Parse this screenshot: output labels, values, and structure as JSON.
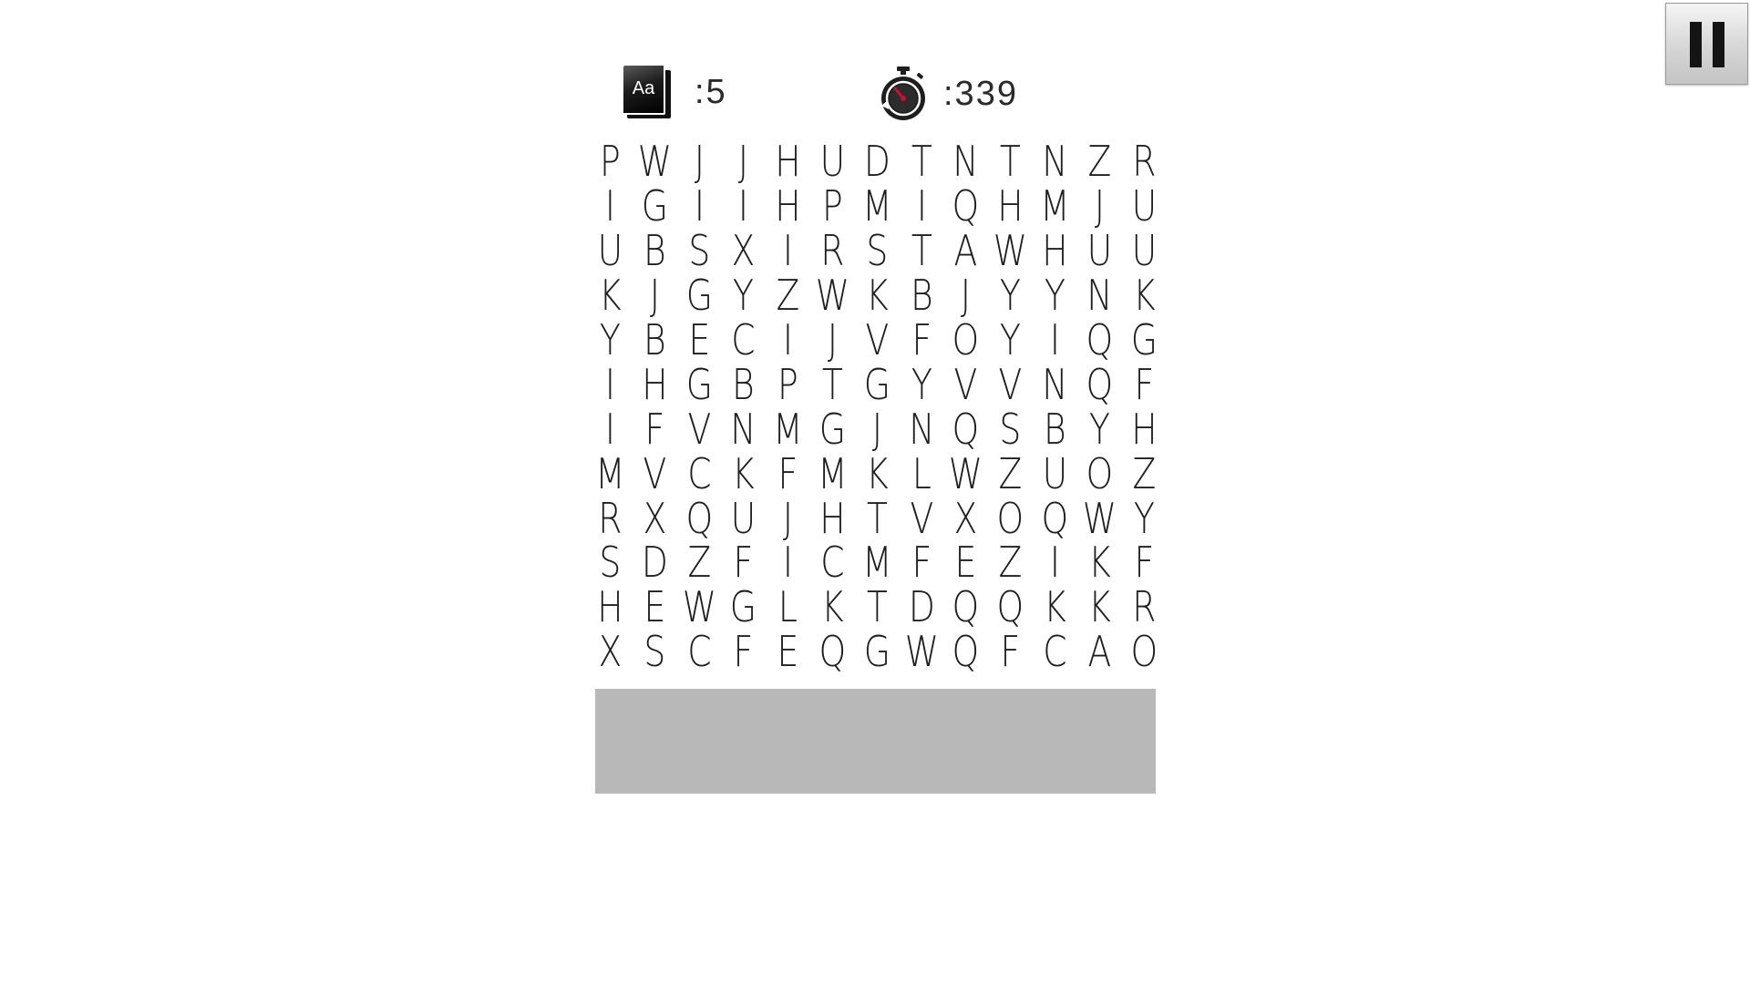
{
  "header": {
    "words_icon": "dictionary-icon",
    "words_icon_text": "Aa",
    "words_remaining": ":5",
    "timer_icon": "stopwatch-icon",
    "time_remaining": ":339"
  },
  "controls": {
    "pause_icon": "pause-icon"
  },
  "colors": {
    "background": "#ffffff",
    "letters": "#1e1e1e",
    "word_panel": "#b8b8b8",
    "timer_needle": "#c8102e"
  },
  "grid": {
    "rows": [
      [
        "P",
        "W",
        "J",
        "J",
        "H",
        "U",
        "D",
        "T",
        "N",
        "T",
        "N",
        "Z",
        "R"
      ],
      [
        "I",
        "G",
        "I",
        "I",
        "H",
        "P",
        "M",
        "I",
        "Q",
        "H",
        "M",
        "J",
        "U"
      ],
      [
        "U",
        "B",
        "S",
        "X",
        "I",
        "R",
        "S",
        "T",
        "A",
        "W",
        "H",
        "U",
        "U"
      ],
      [
        "K",
        "J",
        "G",
        "Y",
        "Z",
        "W",
        "K",
        "B",
        "J",
        "Y",
        "Y",
        "N",
        "K"
      ],
      [
        "Y",
        "B",
        "E",
        "C",
        "I",
        "J",
        "V",
        "F",
        "O",
        "Y",
        "I",
        "Q",
        "G"
      ],
      [
        "I",
        "H",
        "G",
        "B",
        "P",
        "T",
        "G",
        "Y",
        "V",
        "V",
        "N",
        "Q",
        "F"
      ],
      [
        "I",
        "F",
        "V",
        "N",
        "M",
        "G",
        "J",
        "N",
        "Q",
        "S",
        "B",
        "Y",
        "H"
      ],
      [
        "M",
        "V",
        "C",
        "K",
        "F",
        "M",
        "K",
        "L",
        "W",
        "Z",
        "U",
        "O",
        "Z"
      ],
      [
        "R",
        "X",
        "Q",
        "U",
        "J",
        "H",
        "T",
        "V",
        "X",
        "O",
        "Q",
        "W",
        "Y"
      ],
      [
        "S",
        "D",
        "Z",
        "F",
        "I",
        "C",
        "M",
        "F",
        "E",
        "Z",
        "I",
        "K",
        "F"
      ],
      [
        "H",
        "E",
        "W",
        "G",
        "L",
        "K",
        "T",
        "D",
        "Q",
        "Q",
        "K",
        "K",
        "R"
      ],
      [
        "X",
        "S",
        "C",
        "F",
        "E",
        "Q",
        "G",
        "W",
        "Q",
        "F",
        "C",
        "A",
        "O"
      ]
    ]
  },
  "word_panel": {
    "words": []
  }
}
